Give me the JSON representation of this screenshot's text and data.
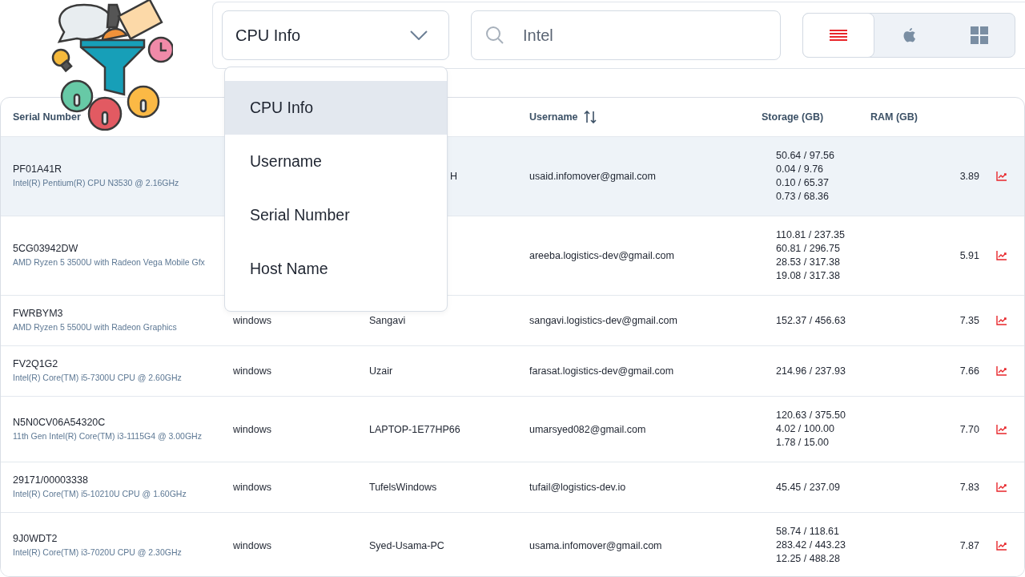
{
  "filter": {
    "value": "CPU Info",
    "options": [
      {
        "label": "CPU Info",
        "selected": true
      },
      {
        "label": "Username",
        "selected": false
      },
      {
        "label": "Serial Number",
        "selected": false
      },
      {
        "label": "Host Name",
        "selected": false
      }
    ]
  },
  "search": {
    "value": "Intel"
  },
  "views": [
    {
      "kind": "list",
      "selected": true
    },
    {
      "kind": "apple",
      "selected": false
    },
    {
      "kind": "grid",
      "selected": false
    }
  ],
  "table": {
    "columns": {
      "serial_number": {
        "label": "Serial Number",
        "sortable": false
      },
      "username": {
        "label": "Username",
        "sortable": true
      },
      "storage": {
        "label": "Storage (GB)",
        "sortable": false
      },
      "ram": {
        "label": "RAM (GB)",
        "sortable": false
      }
    },
    "rows": [
      {
        "selected": true,
        "serial": "PF01A41R",
        "cpu": "Intel(R) Pentium(R) CPU N3530 @ 2.16GHz",
        "host": "H",
        "username": "usaid.infomover@gmail.com",
        "storage": [
          "50.64 / 97.56",
          "0.04 / 9.76",
          "0.10 / 65.37",
          "0.73 / 68.36"
        ],
        "ram": "3.89"
      },
      {
        "selected": false,
        "serial": "5CG03942DW",
        "cpu": "AMD Ryzen 5 3500U with Radeon Vega Mobile Gfx",
        "username": "areeba.logistics-dev@gmail.com",
        "storage": [
          "110.81 / 237.35",
          "60.81 / 296.75",
          "28.53 / 317.38",
          "19.08 / 317.38"
        ],
        "ram": "5.91"
      },
      {
        "selected": false,
        "serial": "FWRBYM3",
        "cpu": "AMD Ryzen 5 5500U with Radeon Graphics",
        "os": "windows",
        "host": "Sangavi",
        "username": "sangavi.logistics-dev@gmail.com",
        "storage": [
          "152.37 / 456.63"
        ],
        "ram": "7.35"
      },
      {
        "selected": false,
        "serial": "FV2Q1G2",
        "cpu": "Intel(R) Core(TM) i5-7300U CPU @ 2.60GHz",
        "os": "windows",
        "host": "Uzair",
        "username": "farasat.logistics-dev@gmail.com",
        "storage": [
          "214.96 / 237.93"
        ],
        "ram": "7.66"
      },
      {
        "selected": false,
        "serial": "N5N0CV06A54320C",
        "cpu": "11th Gen Intel(R) Core(TM) i3-1115G4 @ 3.00GHz",
        "os": "windows",
        "host": "LAPTOP-1E77HP66",
        "username": "umarsyed082@gmail.com",
        "storage": [
          "120.63 / 375.50",
          "4.02 / 100.00",
          "1.78 / 15.00"
        ],
        "ram": "7.70"
      },
      {
        "selected": false,
        "serial": "29171/00003338",
        "cpu": "Intel(R) Core(TM) i5-10210U CPU @ 1.60GHz",
        "os": "windows",
        "host": "TufelsWindows",
        "username": "tufail@logistics-dev.io",
        "storage": [
          "45.45 / 237.09"
        ],
        "ram": "7.83"
      },
      {
        "selected": false,
        "serial": "9J0WDT2",
        "cpu": "Intel(R) Core(TM) i3-7020U CPU @ 2.30GHz",
        "os": "windows",
        "host": "Syed-Usama-PC",
        "username": "usama.infomover@gmail.com",
        "storage": [
          "58.74 / 118.61",
          "283.42 / 443.23",
          "12.25 / 488.28"
        ],
        "ram": "7.87"
      }
    ]
  }
}
